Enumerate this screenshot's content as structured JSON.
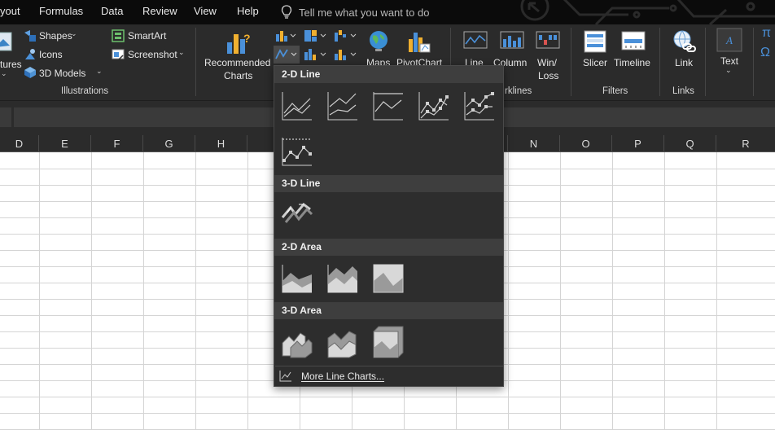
{
  "menu": {
    "tabs": [
      "yout",
      "Formulas",
      "Data",
      "Review",
      "View",
      "Help"
    ],
    "tell_me": "Tell me what you want to do"
  },
  "ribbon": {
    "pictures_label": "tures",
    "shapes": "Shapes",
    "icons": "Icons",
    "models_3d": "3D Models",
    "smartart": "SmartArt",
    "screenshot": "Screenshot",
    "illustrations_group": "Illustrations",
    "recommended_line1": "Recommended",
    "recommended_line2": "Charts",
    "maps": "Maps",
    "pivotchart": "PivotChart",
    "spark_line": "Line",
    "spark_column": "Column",
    "spark_winloss_line1": "Win/",
    "spark_winloss_line2": "Loss",
    "sparklines_group": "rklines",
    "slicer": "Slicer",
    "timeline": "Timeline",
    "filters_group": "Filters",
    "link": "Link",
    "links_group": "Links",
    "text": "Text",
    "pi": "π",
    "omega": "Ω"
  },
  "columns": [
    "D",
    "E",
    "F",
    "G",
    "H",
    "",
    "",
    "",
    "",
    "",
    "N",
    "O",
    "P",
    "Q",
    "R"
  ],
  "dropdown": {
    "sections": [
      "2-D Line",
      "3-D Line",
      "2-D Area",
      "3-D Area"
    ],
    "more": "More Line Charts...",
    "items_2d_line": [
      "Line",
      "Stacked Line",
      "100% Stacked Line",
      "Line with Markers",
      "Stacked Line with Markers",
      "100% Stacked Line with Markers"
    ],
    "items_3d_line": [
      "3-D Line"
    ],
    "items_2d_area": [
      "Area",
      "Stacked Area",
      "100% Stacked Area"
    ],
    "items_3d_area": [
      "3-D Area",
      "3-D Stacked Area",
      "3-D 100% Stacked Area"
    ]
  },
  "colors": {
    "menubar": "#0b0b0b",
    "ribbon": "#2b2b2b",
    "dropdown": "#2d2d2d",
    "section_header": "#3e3e3e",
    "grid_line": "#d4d4d4"
  }
}
